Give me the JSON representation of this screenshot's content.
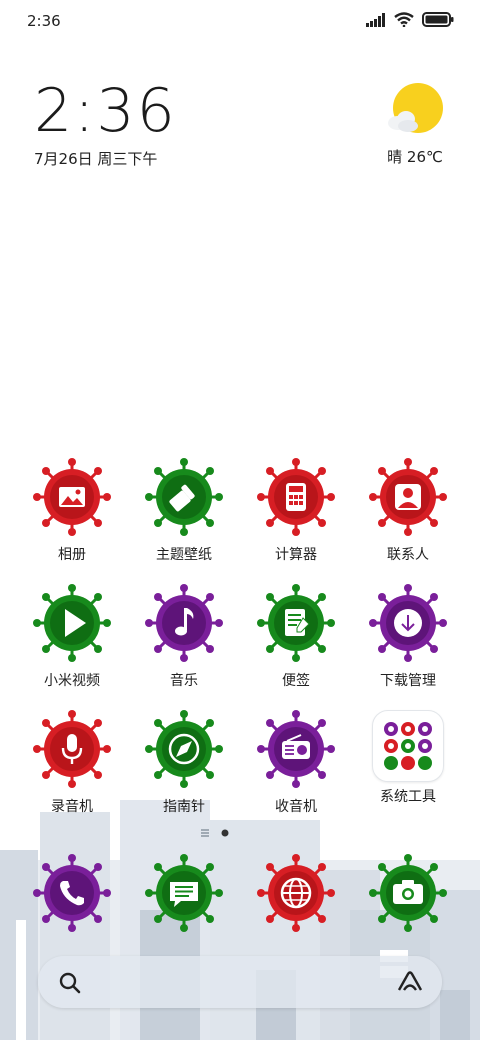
{
  "status_bar": {
    "time": "2:36"
  },
  "clock": {
    "time": "2:36",
    "date": "7月26日 周三下午"
  },
  "weather": {
    "temp": "晴 26℃"
  },
  "apps": [
    {
      "label": "相册",
      "icon": "gallery-icon",
      "color": "#d71e24"
    },
    {
      "label": "主题壁纸",
      "icon": "theme-brush-icon",
      "color": "#178a1c"
    },
    {
      "label": "计算器",
      "icon": "calculator-icon",
      "color": "#d71e24"
    },
    {
      "label": "联系人",
      "icon": "contacts-icon",
      "color": "#d71e24"
    },
    {
      "label": "小米视频",
      "icon": "video-play-icon",
      "color": "#178a1c"
    },
    {
      "label": "音乐",
      "icon": "music-note-icon",
      "color": "#7a1f9a"
    },
    {
      "label": "便签",
      "icon": "notes-icon",
      "color": "#178a1c"
    },
    {
      "label": "下载管理",
      "icon": "download-icon",
      "color": "#7a1f9a"
    },
    {
      "label": "录音机",
      "icon": "microphone-icon",
      "color": "#d71e24"
    },
    {
      "label": "指南针",
      "icon": "compass-icon",
      "color": "#178a1c"
    },
    {
      "label": "收音机",
      "icon": "radio-icon",
      "color": "#7a1f9a"
    },
    {
      "label": "系统工具",
      "icon": "folder-icon",
      "color": "#ffffff"
    }
  ],
  "dock": [
    {
      "icon": "phone-icon",
      "color": "#7a1f9a"
    },
    {
      "icon": "messages-icon",
      "color": "#178a1c"
    },
    {
      "icon": "browser-globe-icon",
      "color": "#d71e24"
    },
    {
      "icon": "camera-icon",
      "color": "#178a1c"
    }
  ]
}
